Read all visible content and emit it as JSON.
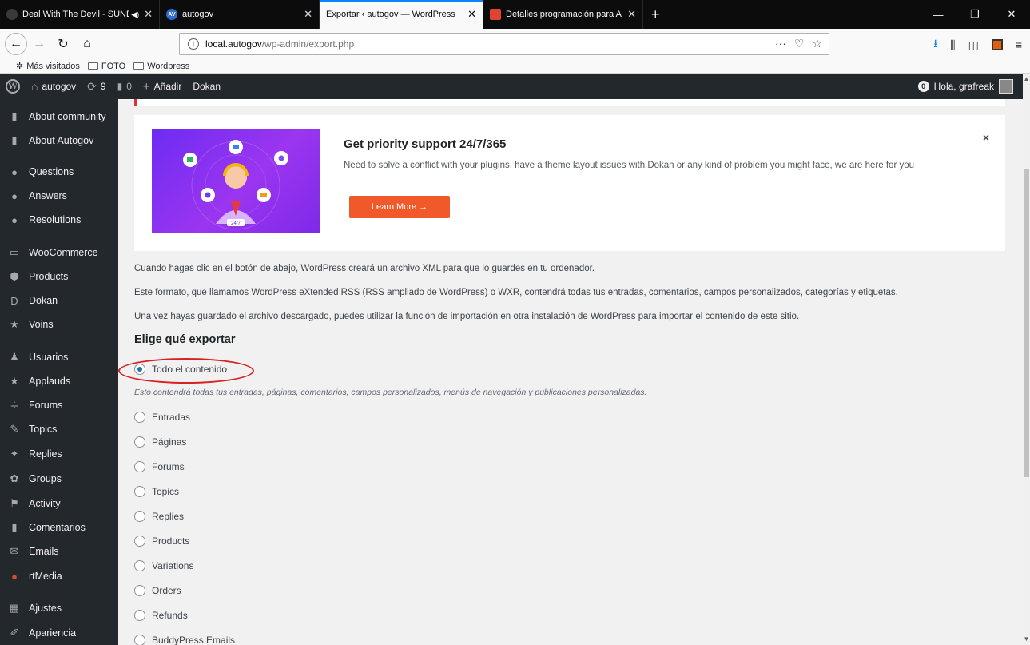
{
  "browser": {
    "tabs": [
      {
        "label": "Deal With The Devil - SUND",
        "favicon_color": "#3a3a3a",
        "audio": true
      },
      {
        "label": "autogov",
        "favicon_text": "AV",
        "favicon_color": "#2d6ec9"
      },
      {
        "label": "Exportar ‹ autogov — WordPress",
        "active": true
      },
      {
        "label": "Detalles programación para AU",
        "favicon_color": "#e0442e"
      }
    ],
    "url_host": "local.autogov",
    "url_path": "/wp-admin/export.php",
    "url_actions": "···",
    "bookmarks": [
      "Más visitados",
      "FOTO",
      "Wordpress"
    ]
  },
  "adminbar": {
    "site_name": "autogov",
    "updates_count": "9",
    "comments_count": "0",
    "add_new": "Añadir",
    "dokan": "Dokan",
    "notif_count": "0",
    "greeting": "Hola, grafreak"
  },
  "sidebar": {
    "items": [
      {
        "label": "About community",
        "icon": "page-icon"
      },
      {
        "label": "About Autogov",
        "icon": "page-icon"
      },
      {
        "label": "Questions",
        "icon": "chat-icon"
      },
      {
        "label": "Answers",
        "icon": "chat-icon"
      },
      {
        "label": "Resolutions",
        "icon": "chat-icon"
      },
      {
        "label": "WooCommerce",
        "icon": "woo-icon"
      },
      {
        "label": "Products",
        "icon": "box-icon"
      },
      {
        "label": "Dokan",
        "icon": "dokan-icon"
      },
      {
        "label": "Voins",
        "icon": "star-icon"
      },
      {
        "label": "Usuarios",
        "icon": "user-icon"
      },
      {
        "label": "Applauds",
        "icon": "star-icon"
      },
      {
        "label": "Forums",
        "icon": "forum-icon"
      },
      {
        "label": "Topics",
        "icon": "topics-icon"
      },
      {
        "label": "Replies",
        "icon": "replies-icon"
      },
      {
        "label": "Groups",
        "icon": "groups-icon"
      },
      {
        "label": "Activity",
        "icon": "activity-icon"
      },
      {
        "label": "Comentarios",
        "icon": "comment-icon"
      },
      {
        "label": "Emails",
        "icon": "mail-icon"
      },
      {
        "label": "rtMedia",
        "icon": "rtmedia-icon"
      },
      {
        "label": "Ajustes",
        "icon": "settings-icon"
      },
      {
        "label": "Apariencia",
        "icon": "brush-icon"
      }
    ]
  },
  "promo": {
    "title": "Get priority support 24/7/365",
    "text": "Need to solve a conflict with your plugins, have a theme layout issues with Dokan or any kind of problem you might face, we are here for you",
    "button": "Learn More →",
    "badge": "24/7",
    "close": "×"
  },
  "export": {
    "intro1": "Cuando hagas clic en el botón de abajo, WordPress creará un archivo XML para que lo guardes en tu ordenador.",
    "intro2": "Este formato, que llamamos WordPress eXtended RSS (RSS ampliado de WordPress) o WXR, contendrá todas tus entradas, comentarios, campos personalizados, categorías y etiquetas.",
    "intro3": "Una vez hayas guardado el archivo descargado, puedes utilizar la función de importación en otra instalación de WordPress para importar el contenido de este sitio.",
    "heading": "Elige qué exportar",
    "all_label": "Todo el contenido",
    "all_desc": "Esto contendrá todas tus entradas, páginas, comentarios, campos personalizados, menús de navegación y publicaciones personalizadas.",
    "options": [
      "Entradas",
      "Páginas",
      "Forums",
      "Topics",
      "Replies",
      "Products",
      "Variations",
      "Orders",
      "Refunds",
      "BuddyPress Emails"
    ]
  }
}
